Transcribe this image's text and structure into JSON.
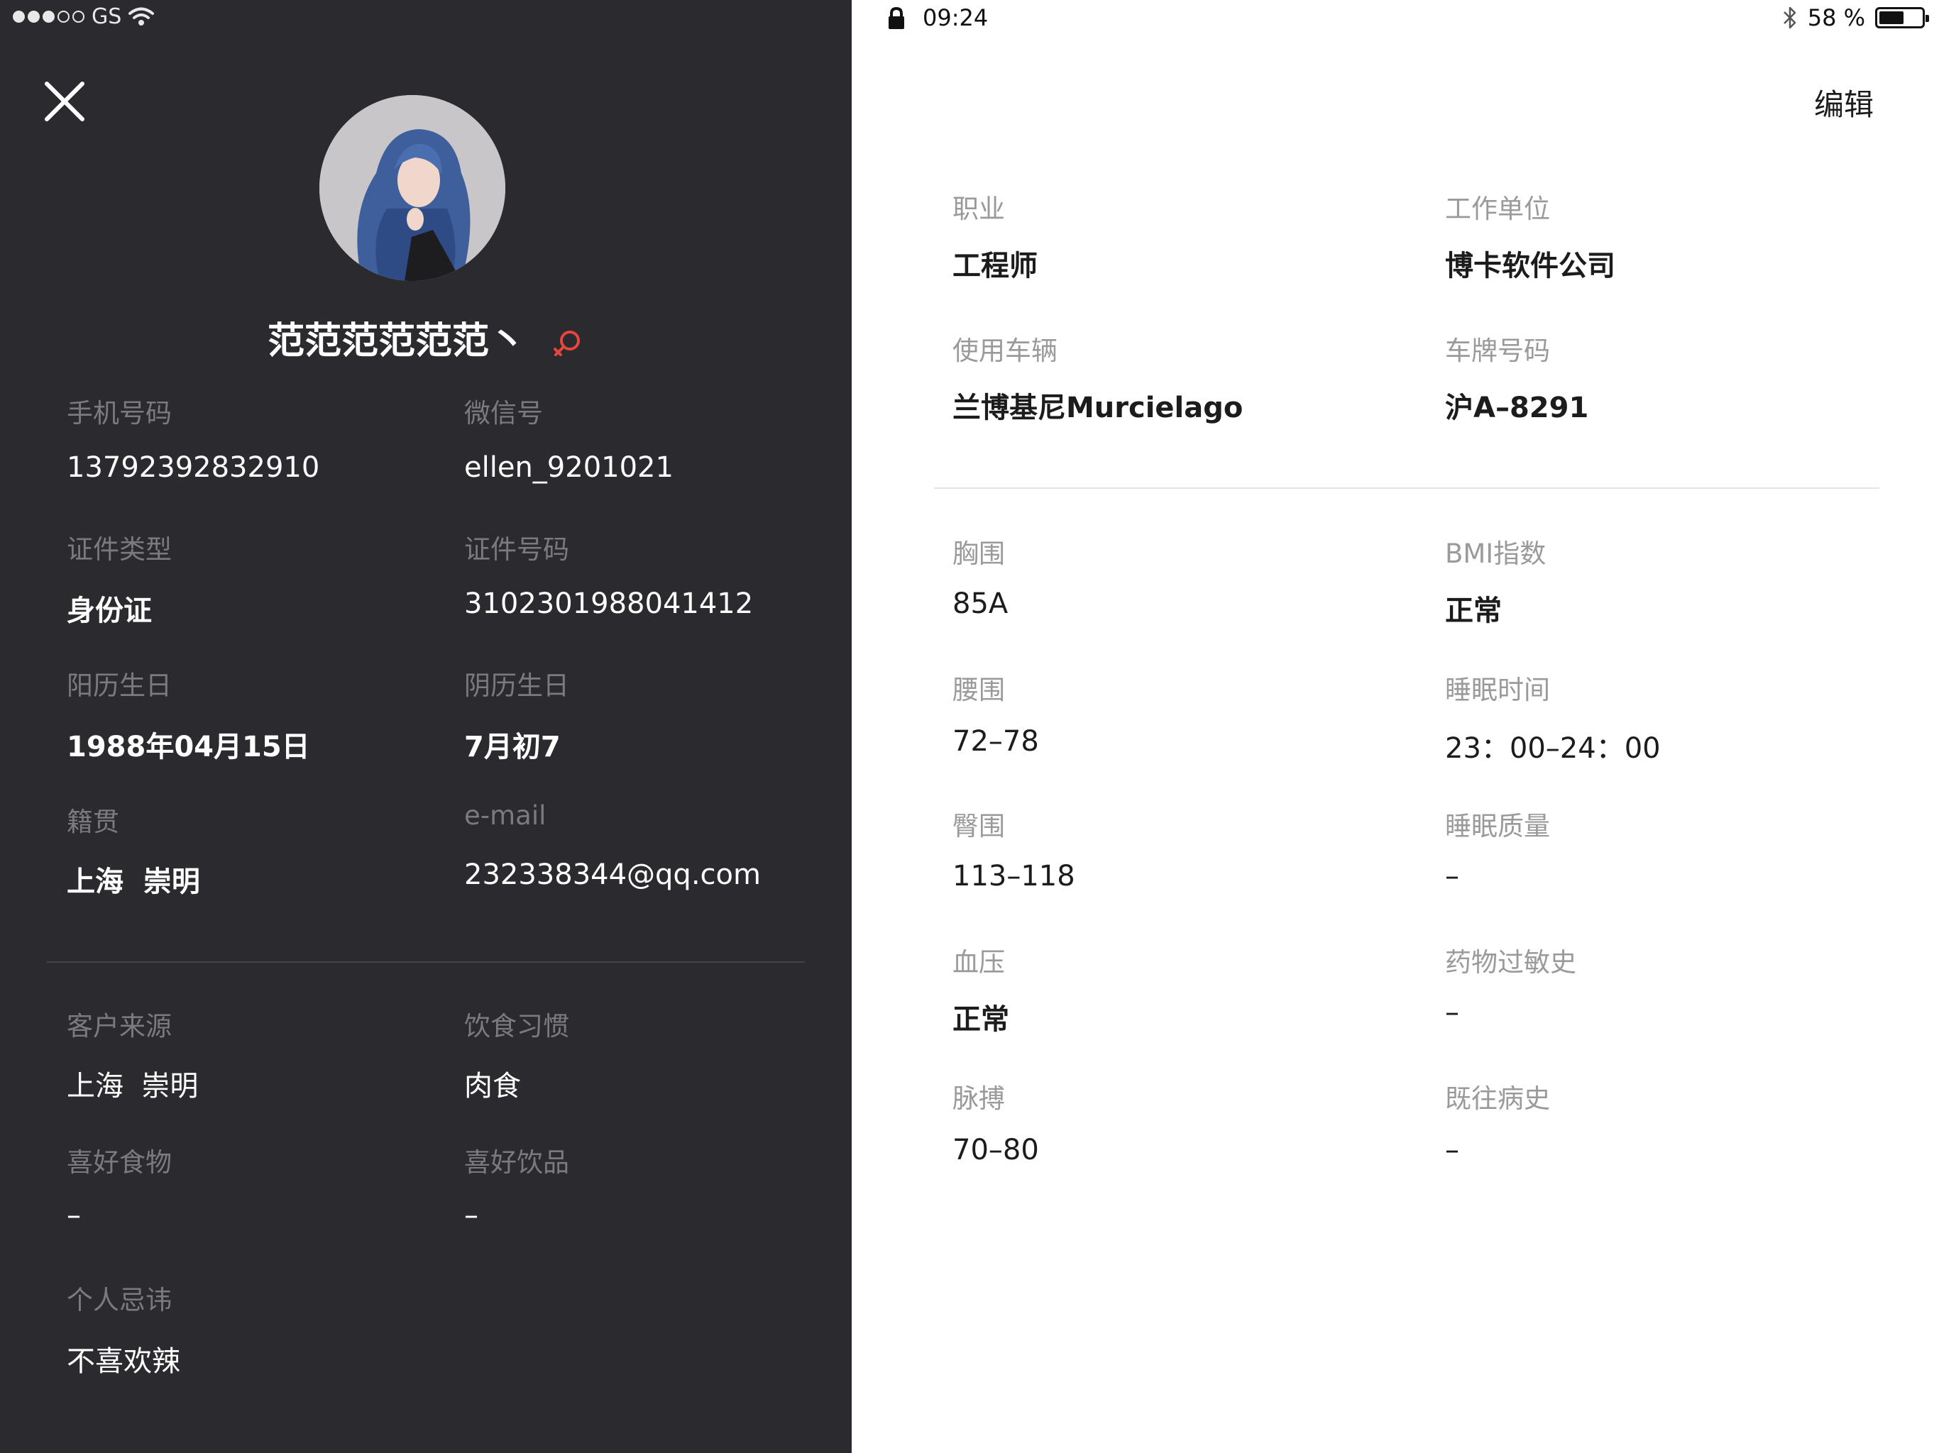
{
  "status_bar": {
    "carrier": "GS",
    "time": "09:24",
    "battery_text": "58 %",
    "battery_level": 0.58
  },
  "profile": {
    "name": "范范范范范范丶",
    "gender_icon": "female-icon",
    "gender_color": "#e8463b",
    "close_icon": "close-icon"
  },
  "basic_info": {
    "phone_label": "手机号码",
    "phone": "13792392832910",
    "wechat_label": "微信号",
    "wechat": "ellen_9201021",
    "id_type_label": "证件类型",
    "id_type": "身份证",
    "id_number_label": "证件号码",
    "id_number": "3102301988041412",
    "solar_birthday_label": "阳历生日",
    "solar_birthday": "1988年04月15日",
    "lunar_birthday_label": "阴历生日",
    "lunar_birthday": "7月初7",
    "hometown_label": "籍贯",
    "hometown": "上海  崇明",
    "email_label": "e-mail",
    "email": "232338344@qq.com"
  },
  "preferences": {
    "source_label": "客户来源",
    "source": "上海  崇明",
    "diet_label": "饮食习惯",
    "diet": "肉食",
    "fav_food_label": "喜好食物",
    "fav_food": "–",
    "fav_drink_label": "喜好饮品",
    "fav_drink": "–",
    "taboo_label": "个人忌讳",
    "taboo": "不喜欢辣"
  },
  "right": {
    "edit_label": "编辑",
    "job_label": "职业",
    "job": "工程师",
    "employer_label": "工作单位",
    "employer": "博卡软件公司",
    "vehicle_label": "使用车辆",
    "vehicle": "兰博基尼Murcielago",
    "plate_label": "车牌号码",
    "plate": "沪A–8291",
    "bust_label": "胸围",
    "bust": "85A",
    "bmi_label": "BMI指数",
    "bmi": "正常",
    "waist_label": "腰围",
    "waist": "72–78",
    "sleep_time_label": "睡眠时间",
    "sleep_time": "23：00–24：00",
    "hip_label": "臀围",
    "hip": "113–118",
    "sleep_quality_label": "睡眠质量",
    "sleep_quality": "–",
    "bp_label": "血压",
    "bp": "正常",
    "allergy_label": "药物过敏史",
    "allergy": "–",
    "pulse_label": "脉搏",
    "pulse": "70–80",
    "history_label": "既往病史",
    "history": "–"
  }
}
